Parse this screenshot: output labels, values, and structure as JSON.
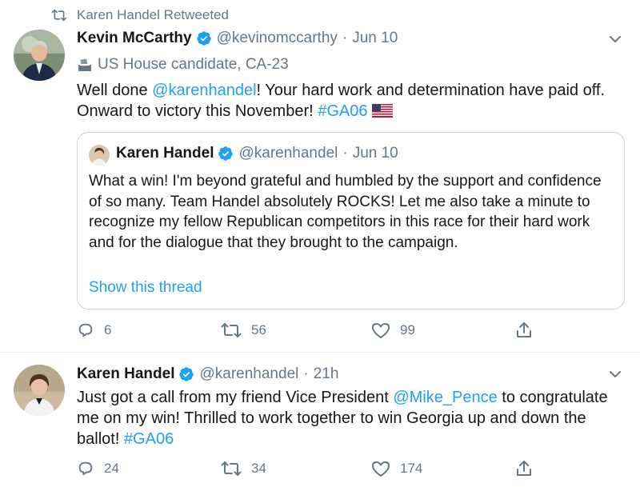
{
  "retweet_context": {
    "text": "Karen Handel Retweeted",
    "icon": "retweet-icon"
  },
  "tweets": [
    {
      "author": {
        "name": "Kevin McCarthy",
        "handle": "@kevinomccarthy",
        "time": "Jun 10"
      },
      "label": {
        "icon": "ballot-box-icon",
        "text": "US House candidate, CA-23"
      },
      "body": {
        "part1": "Well done ",
        "mention": "@karenhandel",
        "part2": "! Your hard work and determination have paid off. Onward to victory this November! ",
        "hashtag": "#GA06",
        "emoji": "us-flag-icon"
      },
      "quote": {
        "author": {
          "name": "Karen Handel",
          "handle": "@karenhandel",
          "time": "Jun 10"
        },
        "text": "What a win! I'm beyond grateful and humbled by the support and confidence of so many. Team Handel absolutely ROCKS! Let me also take a minute to recognize my fellow Republican competitors in this race for their hard work and for the dialogue that they brought to the campaign.",
        "show_thread": "Show this thread"
      },
      "actions": {
        "replies": "6",
        "retweets": "56",
        "likes": "99"
      }
    },
    {
      "author": {
        "name": "Karen Handel",
        "handle": "@karenhandel",
        "time": "21h"
      },
      "body": {
        "part1": "Just got a call from my friend Vice President ",
        "mention": "@Mike_Pence",
        "part2": " to congratulate me on my win! Thrilled to work together to win Georgia up and down the ballot! ",
        "hashtag": "#GA06"
      },
      "actions": {
        "replies": "24",
        "retweets": "34",
        "likes": "174"
      }
    }
  ],
  "separator": "·",
  "colors": {
    "link": "#1da1f2",
    "muted": "#657786",
    "verified": "#1da1f2",
    "border": "#ccd6dd"
  }
}
